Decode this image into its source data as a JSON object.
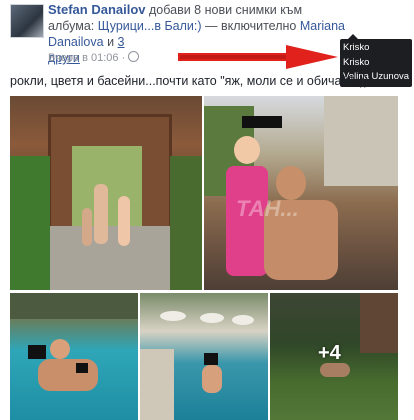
{
  "post": {
    "author": "Stefan Danailov",
    "action_text": " добави 8 нови снимки към албума: ",
    "album_name": "Щурици...в Бали:)",
    "including_text": " — включително ",
    "tagged_person": "Mariana Danailova",
    "and_text": " и ",
    "others_count": "3",
    "others_label": "други",
    "timestamp": "Вчера в 01:06 ·",
    "caption": "рокли, цветя и басейни...почти като \"яж, моли се и обичай\" :))",
    "more_photos": "+4",
    "watermark": "ТАН..."
  },
  "tooltip": {
    "names": [
      "Krisko",
      "Krisko",
      "Velina Uzunova"
    ]
  },
  "colors": {
    "link": "#365899",
    "arrow": "#e0211c",
    "tooltip_bg": "#1c1e21"
  }
}
